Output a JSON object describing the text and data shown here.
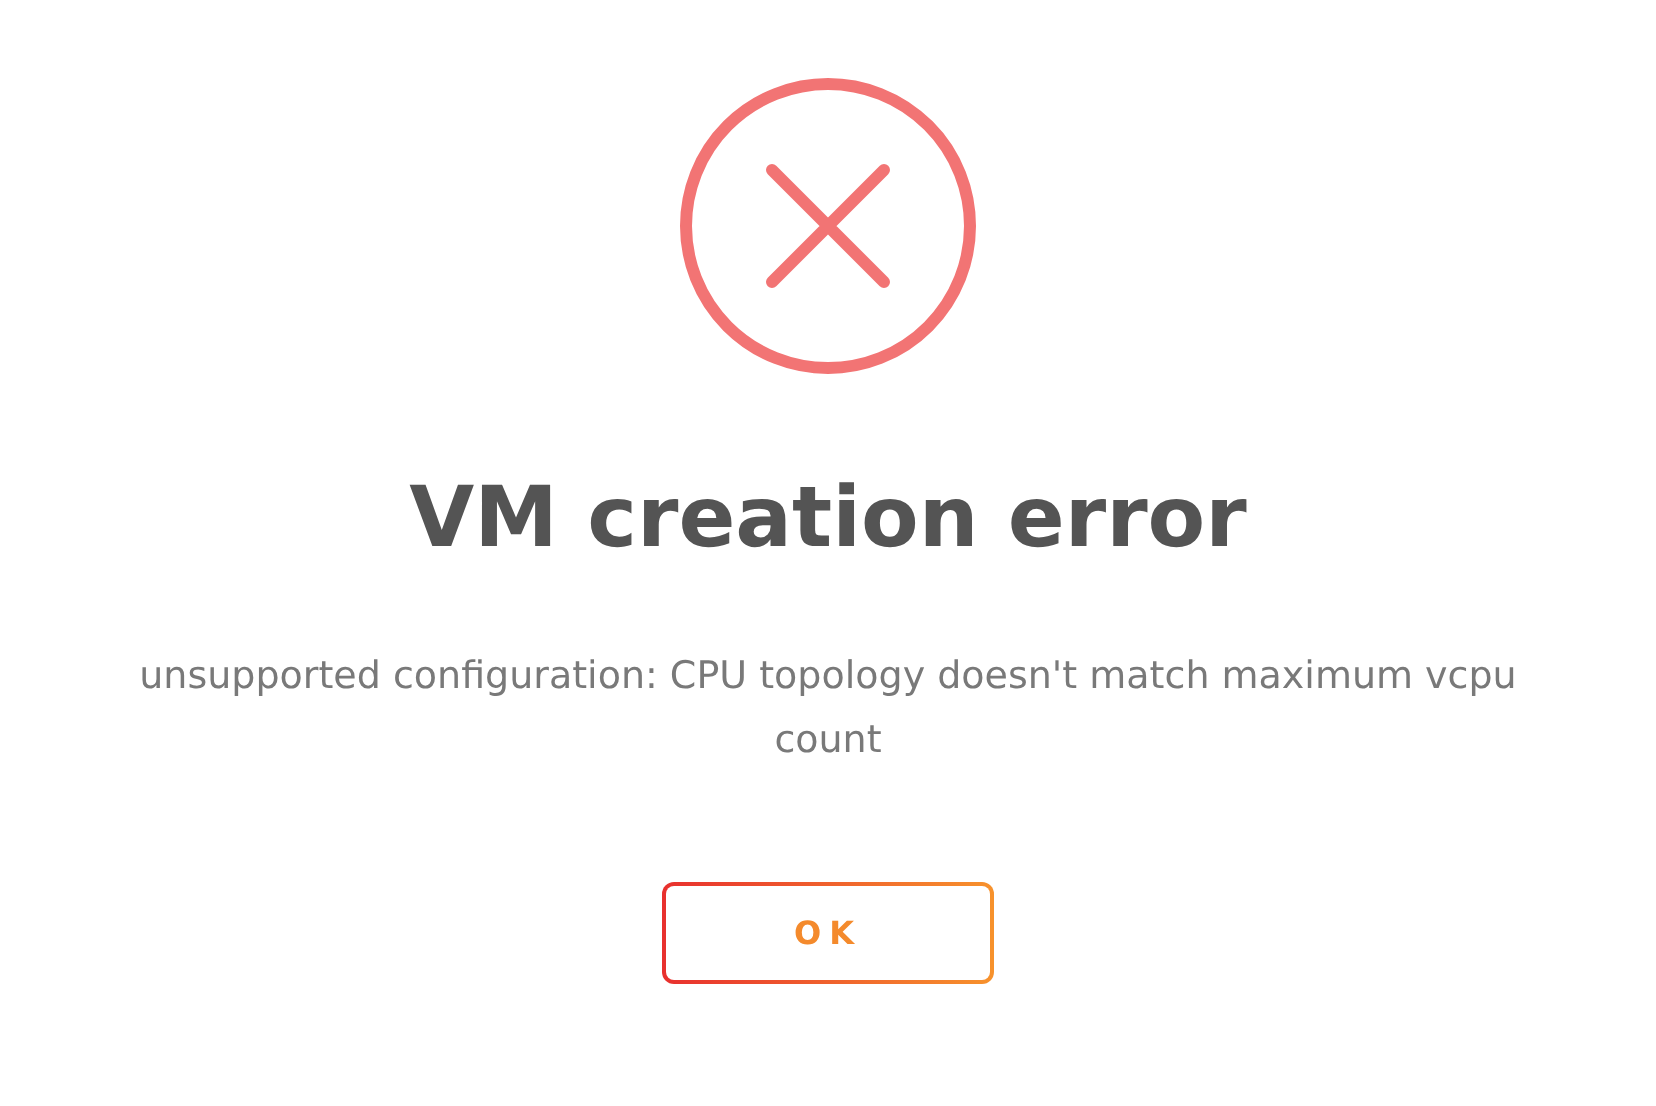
{
  "dialog": {
    "icon": {
      "kind": "error"
    },
    "title": "VM creation error",
    "message": "unsupported configuration: CPU topology doesn't match maximum vcpu count",
    "buttons": [
      {
        "label": "OK"
      }
    ]
  }
}
